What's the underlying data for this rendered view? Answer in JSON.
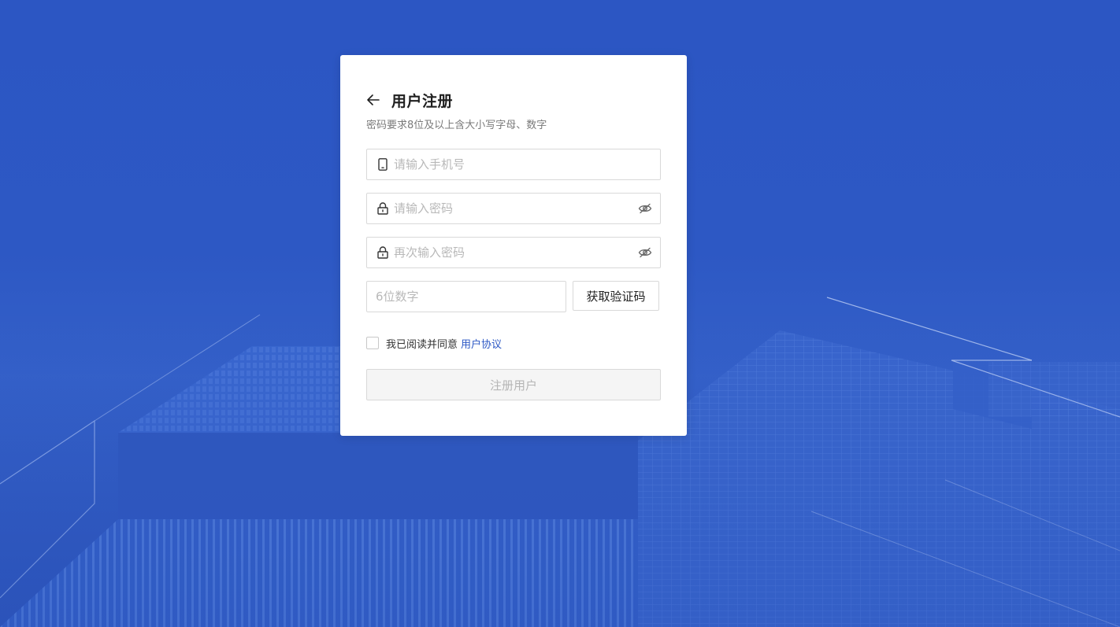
{
  "form": {
    "title": "用户注册",
    "subtitle": "密码要求8位及以上含大小写字母、数字",
    "phone": {
      "placeholder": "请输入手机号",
      "value": "",
      "icon": "mobile-phone-icon"
    },
    "password": {
      "placeholder": "请输入密码",
      "value": "",
      "icon": "lock-icon",
      "toggle_icon": "eye-hidden-icon"
    },
    "password_confirm": {
      "placeholder": "再次输入密码",
      "value": "",
      "icon": "lock-icon",
      "toggle_icon": "eye-hidden-icon"
    },
    "code": {
      "placeholder": "6位数字",
      "value": ""
    },
    "get_code_label": "获取验证码",
    "agree_text": "我已阅读并同意",
    "agreement_link": "用户协议",
    "agreed": false,
    "submit_label": "注册用户",
    "back_icon": "arrow-left-icon"
  },
  "colors": {
    "background": "#2c56c3",
    "card": "#ffffff",
    "link": "#2b57c4",
    "submit_disabled_bg": "#f5f5f5",
    "submit_disabled_text": "#b5b5b5"
  }
}
